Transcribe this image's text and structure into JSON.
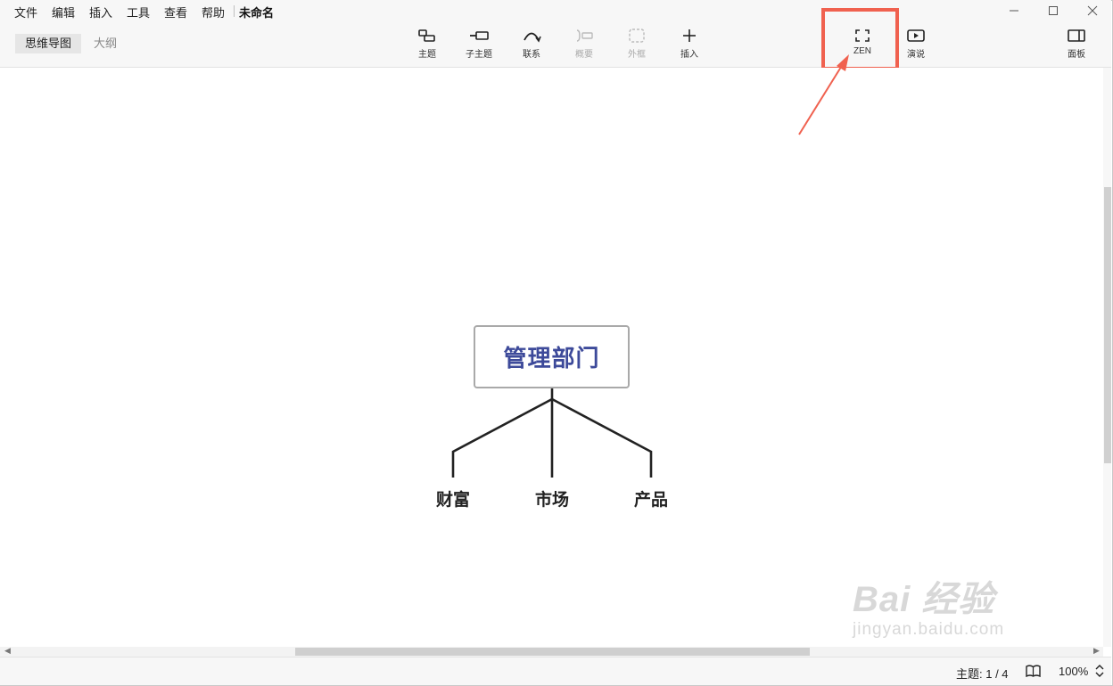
{
  "menu": {
    "items": [
      "文件",
      "编辑",
      "插入",
      "工具",
      "查看",
      "帮助"
    ],
    "doc_title": "未命名"
  },
  "views": {
    "mindmap_tab": "思维导图",
    "outline_tab": "大纲"
  },
  "toolbar": {
    "topic": "主题",
    "subtopic": "子主题",
    "relationship": "联系",
    "summary": "概要",
    "boundary": "外框",
    "insert": "插入",
    "zen": "ZEN",
    "present": "演说",
    "panel": "面板"
  },
  "mindmap": {
    "central": "管理部门",
    "children": [
      "财富",
      "市场",
      "产品"
    ]
  },
  "status": {
    "topics": "主题: 1 / 4",
    "zoom": "100%"
  },
  "watermark": {
    "line1": "Bai 经验",
    "line2": "jingyan.baidu.com"
  },
  "colors": {
    "highlight": "#f0614f",
    "central_text": "#3d4a9a",
    "connector": "#222222"
  }
}
